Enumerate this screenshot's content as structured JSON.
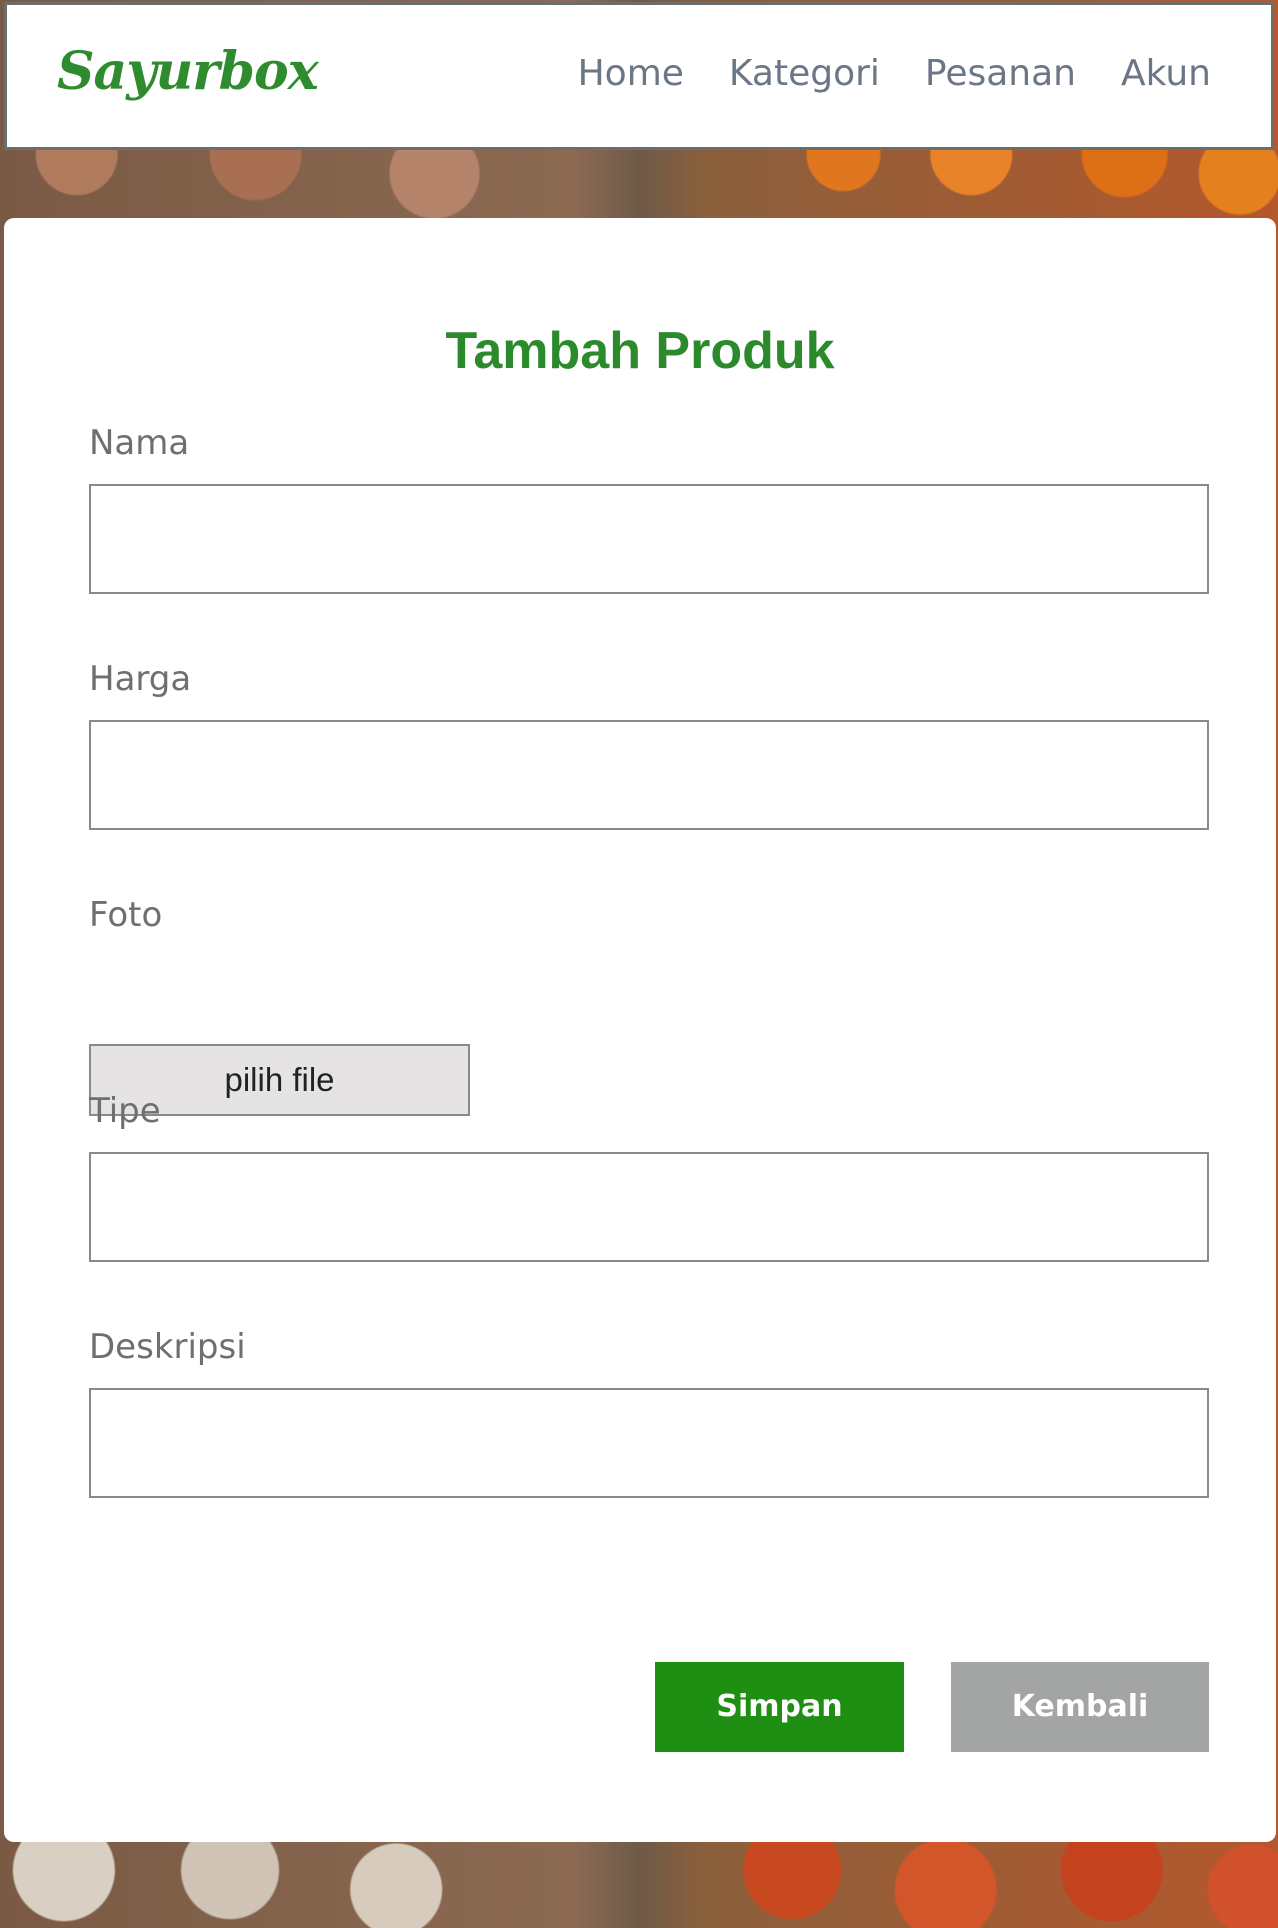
{
  "brand": "Sayurbox",
  "nav": {
    "items": [
      "Home",
      "Kategori",
      "Pesanan",
      "Akun"
    ]
  },
  "form": {
    "title": "Tambah Produk",
    "fields": {
      "nama": {
        "label": "Nama",
        "value": ""
      },
      "harga": {
        "label": "Harga",
        "value": ""
      },
      "foto": {
        "label": "Foto",
        "button": "pilih file"
      },
      "tipe": {
        "label": "Tipe",
        "value": ""
      },
      "deskripsi": {
        "label": "Deskripsi",
        "value": ""
      }
    },
    "buttons": {
      "save": "Simpan",
      "back": "Kembali"
    }
  },
  "colors": {
    "brand": "#2e8b2e",
    "save": "#1e8f12",
    "back": "#a3a5a4",
    "nav_text": "#6b7686"
  }
}
